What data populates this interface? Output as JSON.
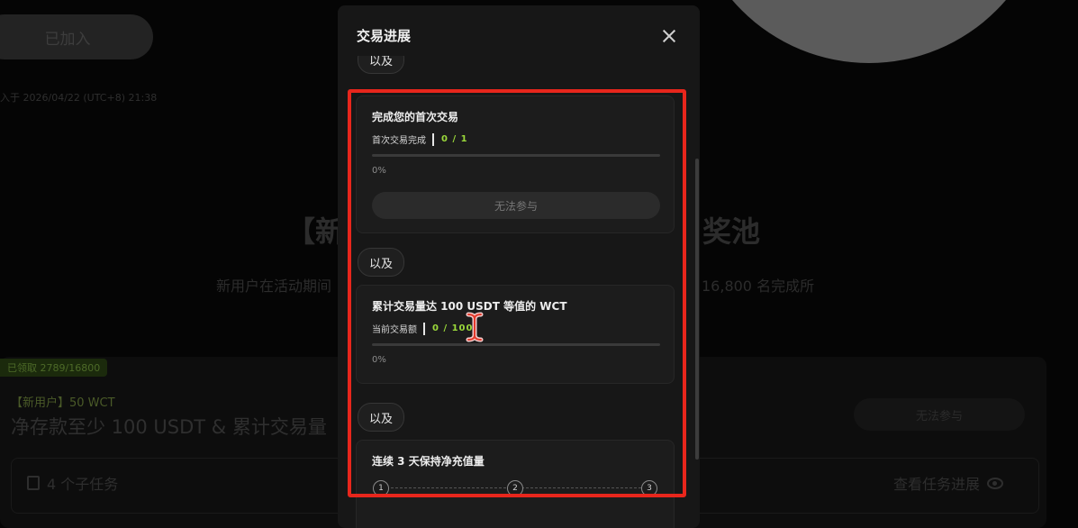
{
  "background": {
    "joined_button": "已加入",
    "joined_time": "入于 2026/04/22 (UTC+8) 21:38",
    "banner_title_left": "【新",
    "banner_title_right": "奖池",
    "banner_sub_left": "新用户在活动期间",
    "banner_sub_right": "16,800 名完成所",
    "task": {
      "claimed_badge": "已领取 2789/16800",
      "tag": "【新用户】50 WCT",
      "title": "净存款至少 100 USDT & 累计交易量",
      "join_button": "无法参与",
      "subtask_count": "4 个子任务",
      "view_progress": "查看任务进展"
    }
  },
  "modal": {
    "title": "交易进展",
    "top_connector": "以及",
    "cards": [
      {
        "title": "完成您的首次交易",
        "metric_label": "首次交易完成",
        "metric_value": "0 / 1",
        "progress": 0,
        "percent_label": "0%",
        "button_label": "无法参与"
      },
      {
        "title": "累计交易量达 100 USDT 等值的 WCT",
        "metric_label": "当前交易额",
        "metric_value": "0 / 100",
        "progress": 0,
        "percent_label": "0%"
      },
      {
        "title": "连续 3 天保持净充值量",
        "steps": [
          "1",
          "2",
          "3"
        ]
      }
    ],
    "connectors": [
      "以及",
      "以及"
    ]
  },
  "colors": {
    "accent_green": "#9bd93b",
    "highlight_red": "#e8261c",
    "modal_bg": "#171717"
  }
}
